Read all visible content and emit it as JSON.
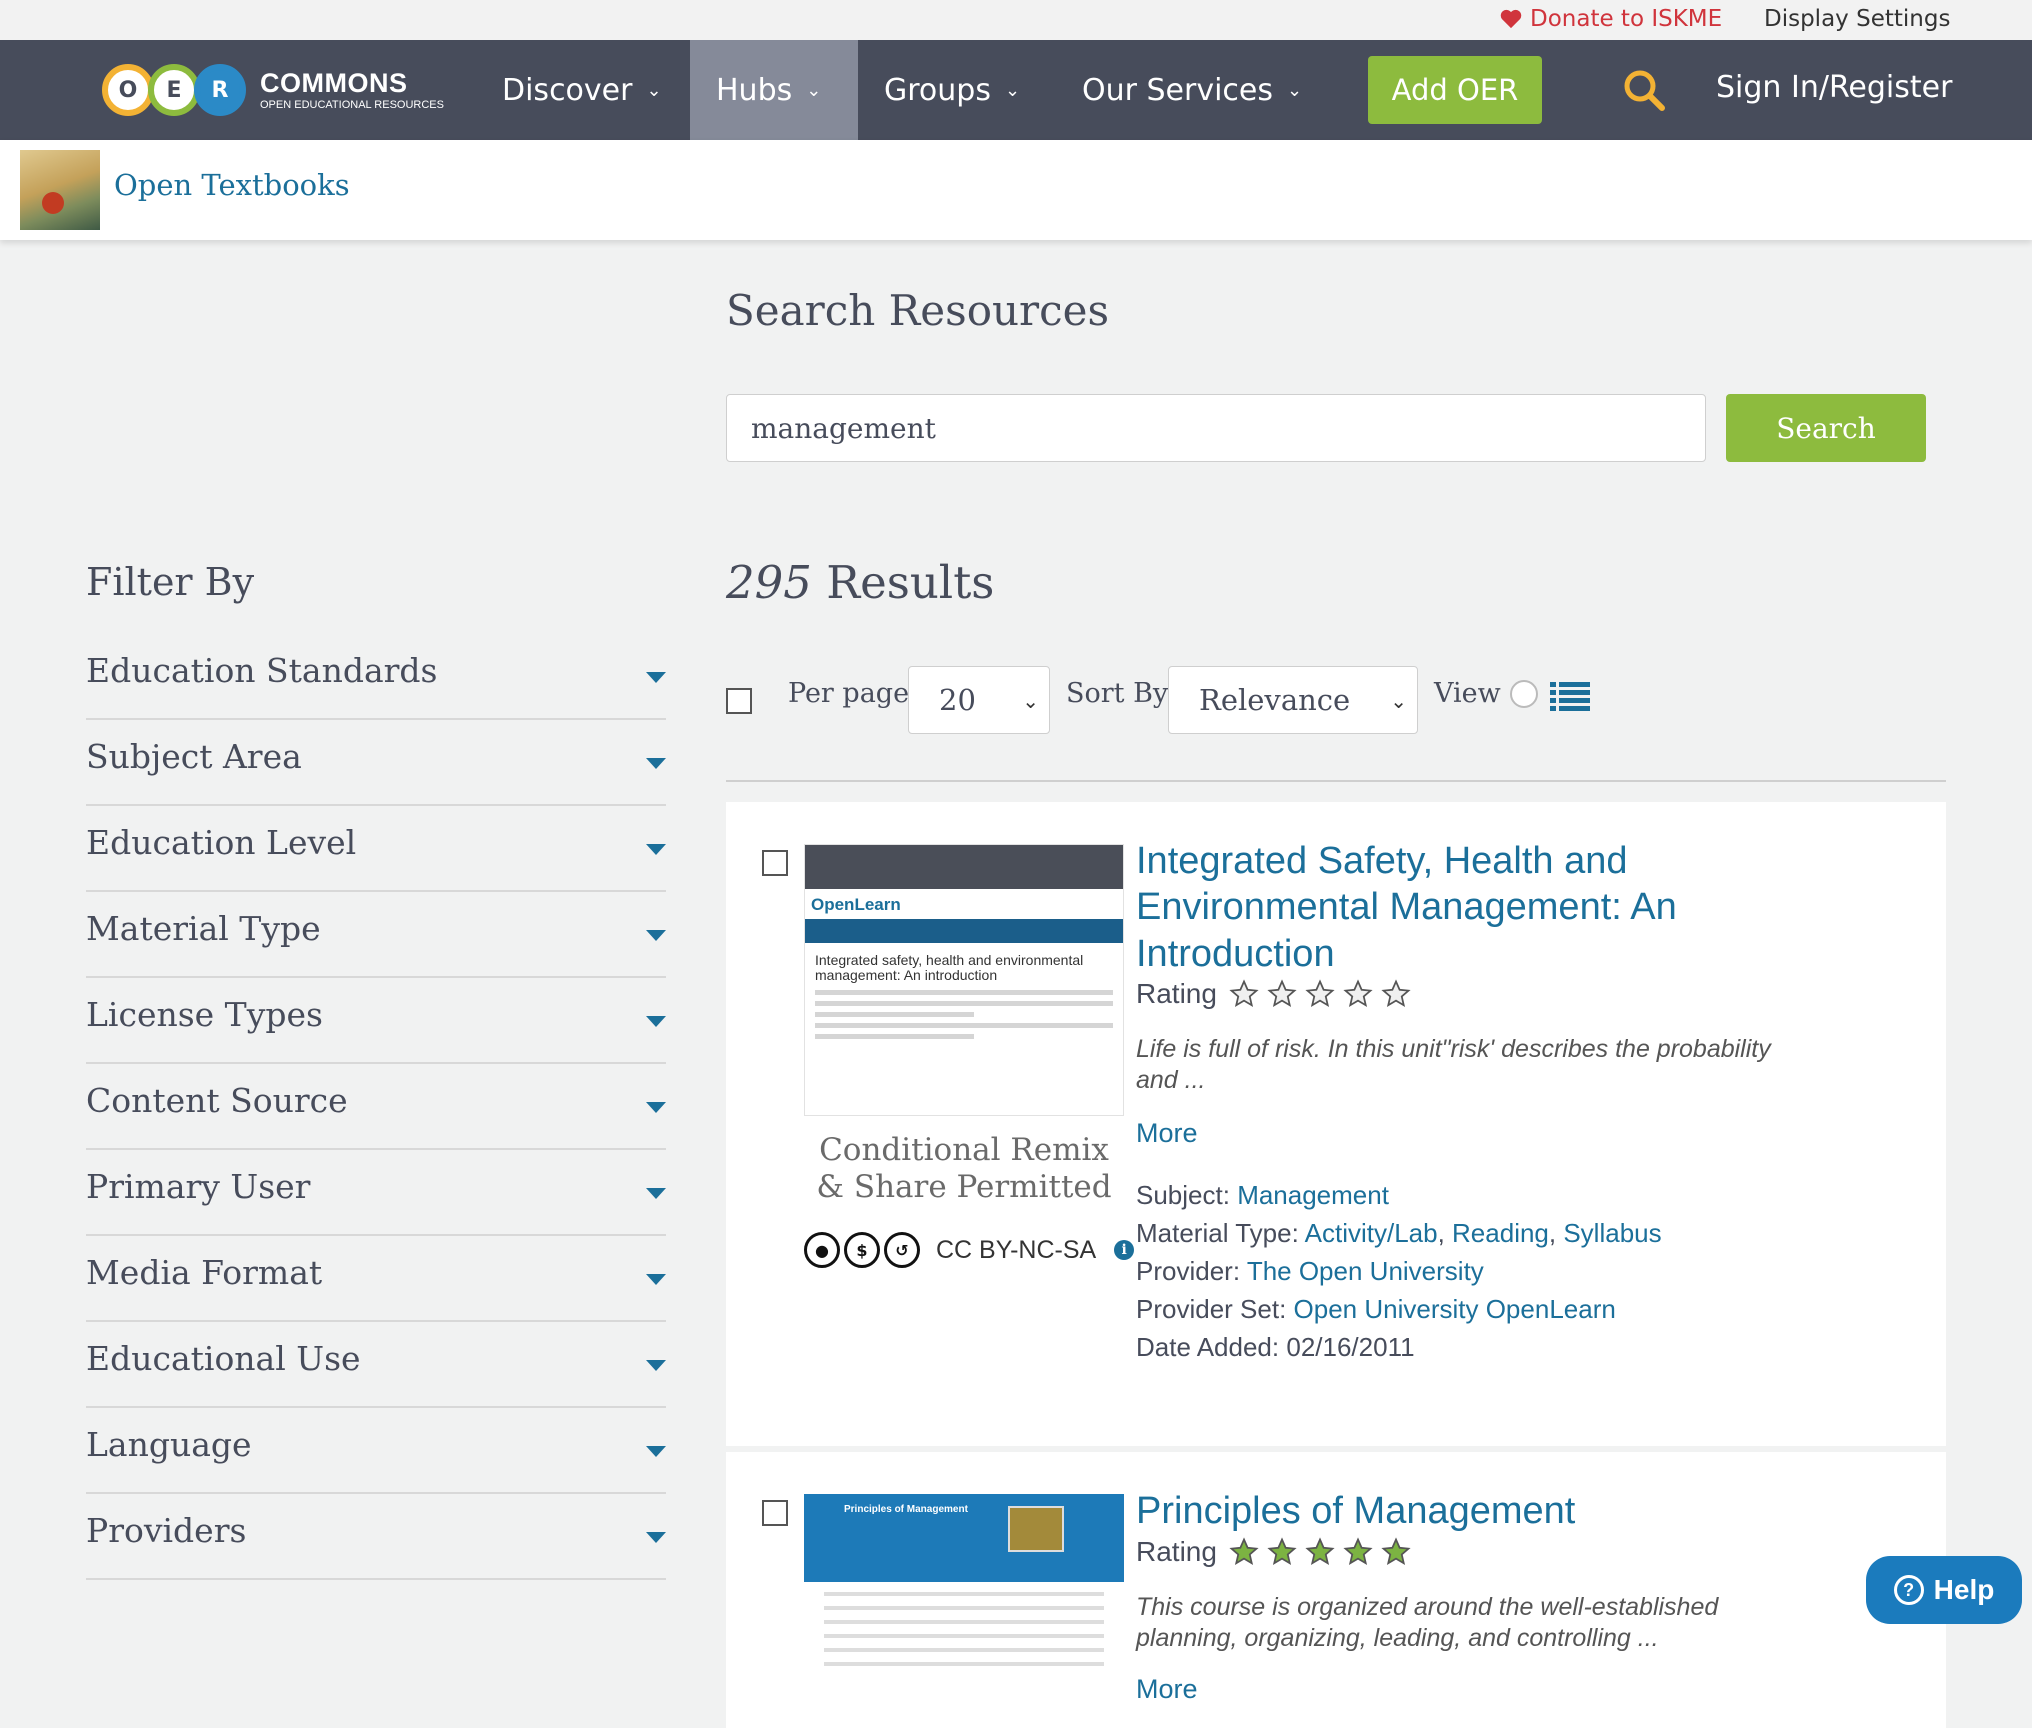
{
  "utility": {
    "donate": "Donate to ISKME",
    "display_settings": "Display Settings"
  },
  "nav": {
    "logo_letters": [
      "O",
      "E",
      "R"
    ],
    "brand": "COMMONS",
    "brand_sub": "OPEN EDUCATIONAL RESOURCES",
    "items": [
      {
        "label": "Discover",
        "active": false
      },
      {
        "label": "Hubs",
        "active": true
      },
      {
        "label": "Groups",
        "active": false
      },
      {
        "label": "Our Services",
        "active": false
      }
    ],
    "add_oer": "Add OER",
    "signin": "Sign In/Register"
  },
  "hub": {
    "title": "Open Textbooks"
  },
  "search": {
    "title": "Search Resources",
    "query": "management",
    "button": "Search"
  },
  "filter": {
    "title": "Filter By",
    "items": [
      "Education Standards",
      "Subject Area",
      "Education Level",
      "Material Type",
      "License Types",
      "Content Source",
      "Primary User",
      "Media Format",
      "Educational Use",
      "Language",
      "Providers"
    ]
  },
  "results": {
    "count": "295",
    "label": "Results",
    "per_page_label": "Per page",
    "per_page_value": "20",
    "sort_label": "Sort By",
    "sort_value": "Relevance",
    "view_label": "View"
  },
  "items": [
    {
      "title": "Integrated Safety, Health and Environmental Management: An Introduction",
      "rating_label": "Rating",
      "rating": 0,
      "description": "Life is full of risk. In this unit\"risk' describes the probability and ...",
      "more": "More",
      "license_text": "Conditional Remix & Share Permitted",
      "license_code": "CC BY-NC-SA",
      "thumb_brand": "OpenLearn",
      "thumb_heading": "Integrated safety, health and environmental management: An introduction",
      "subject_label": "Subject:",
      "subject": "Management",
      "material_label": "Material Type:",
      "materials": [
        "Activity/Lab",
        "Reading",
        "Syllabus"
      ],
      "provider_label": "Provider:",
      "provider": "The Open University",
      "provider_set_label": "Provider Set:",
      "provider_set": "Open University OpenLearn",
      "date_label": "Date Added:",
      "date": "02/16/2011"
    },
    {
      "title": "Principles of Management",
      "rating_label": "Rating",
      "rating": 5,
      "description": "This course is organized around the well-established planning, organizing, leading, and controlling ...",
      "more": "More",
      "thumb_heading": "Principles of Management"
    }
  ],
  "help": "Help",
  "colors": {
    "nav": "#474c5b",
    "green": "#8dbb3e",
    "link": "#1b6f9a",
    "star_filled": "#7cb342"
  }
}
